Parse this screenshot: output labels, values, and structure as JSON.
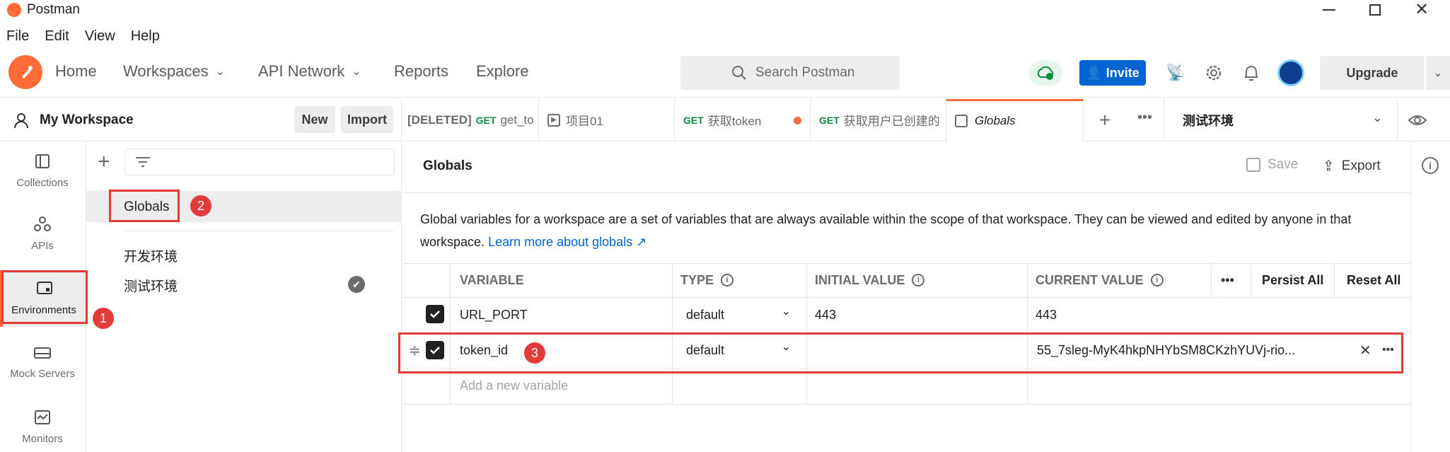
{
  "app": {
    "title": "Postman"
  },
  "menu": [
    "File",
    "Edit",
    "View",
    "Help"
  ],
  "nav": {
    "home": "Home",
    "workspaces": "Workspaces",
    "api_network": "API Network",
    "reports": "Reports",
    "explore": "Explore"
  },
  "search": {
    "placeholder": "Search Postman"
  },
  "header": {
    "invite": "Invite",
    "upgrade": "Upgrade"
  },
  "workspace": {
    "name": "My Workspace",
    "new_label": "New",
    "import_label": "Import"
  },
  "sidebar": {
    "collections": "Collections",
    "apis": "APIs",
    "environments": "Environments",
    "mock_servers": "Mock Servers",
    "monitors": "Monitors"
  },
  "env_list": {
    "globals": "Globals",
    "items": [
      "开发环境",
      "测试环境"
    ]
  },
  "tabs": [
    {
      "prefix": "[DELETED]",
      "method": "GET",
      "label": "get_to"
    },
    {
      "label": "项目01"
    },
    {
      "method": "GET",
      "label": "获取token"
    },
    {
      "method": "GET",
      "label": "获取用户已创建的"
    },
    {
      "label": "Globals"
    }
  ],
  "env_selector": {
    "selected": "测试环境"
  },
  "globals": {
    "title": "Globals",
    "save": "Save",
    "export": "Export",
    "description": "Global variables for a workspace are a set of variables that are always available within the scope of that workspace. They can be viewed and edited by anyone in that workspace.",
    "learn_more": "Learn more about globals ↗",
    "columns": {
      "variable": "VARIABLE",
      "type": "TYPE",
      "initial": "INITIAL VALUE",
      "current": "CURRENT VALUE",
      "persist_all": "Persist All",
      "reset_all": "Reset All"
    },
    "rows": [
      {
        "variable": "URL_PORT",
        "type": "default",
        "initial": "443",
        "current": "443",
        "checked": true
      },
      {
        "variable": "token_id",
        "type": "default",
        "initial": "",
        "current": "55_7sleg-MyK4hkpNHYbSM8CKzhYUVj-rio...",
        "checked": true
      }
    ],
    "add_placeholder": "Add a new variable"
  },
  "annotations": [
    "1",
    "2",
    "3"
  ],
  "colors": {
    "accent": "#ff6c37",
    "invite": "#0265d2",
    "link": "#0265d2",
    "annotation": "#e33a3a"
  }
}
